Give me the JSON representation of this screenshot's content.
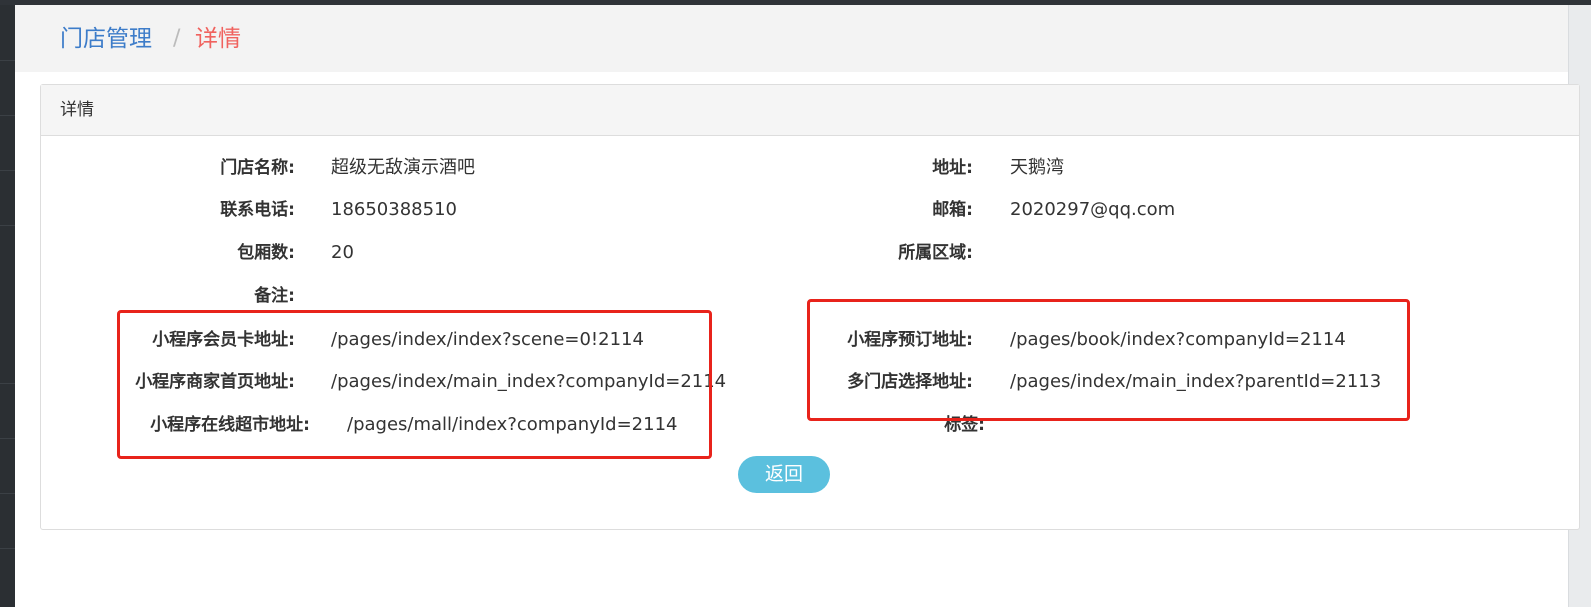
{
  "breadcrumb": {
    "parent": "门店管理",
    "separator": "/",
    "current": "详情"
  },
  "panel": {
    "title": "详情"
  },
  "fields": {
    "store_name": {
      "label": "门店名称:",
      "value": "超级无敌演示酒吧"
    },
    "address": {
      "label": "地址:",
      "value": "天鹅湾"
    },
    "phone": {
      "label": "联系电话:",
      "value": "18650388510"
    },
    "email": {
      "label": "邮箱:",
      "value": "2020297@qq.com"
    },
    "rooms": {
      "label": "包厢数:",
      "value": "20"
    },
    "region": {
      "label": "所属区域:",
      "value": ""
    },
    "remark": {
      "label": "备注:",
      "value": ""
    },
    "member_card_url": {
      "label": "小程序会员卡地址:",
      "value": "/pages/index/index?scene=0!2114"
    },
    "booking_url": {
      "label": "小程序预订地址:",
      "value": "/pages/book/index?companyId=2114"
    },
    "merchant_home_url": {
      "label": "小程序商家首页地址:",
      "value": "/pages/index/main_index?companyId=2114"
    },
    "multi_store_url": {
      "label": "多门店选择地址:",
      "value": "/pages/index/main_index?parentId=2113"
    },
    "mall_url": {
      "label": "小程序在线超市地址:",
      "value": "/pages/mall/index?companyId=2114"
    },
    "tags": {
      "label": "标签:",
      "value": ""
    }
  },
  "actions": {
    "back_label": "返回"
  },
  "colors": {
    "link": "#3d7cc9",
    "current": "#f0625e",
    "button": "#5bc0de",
    "highlight_box": "#e8231b"
  }
}
